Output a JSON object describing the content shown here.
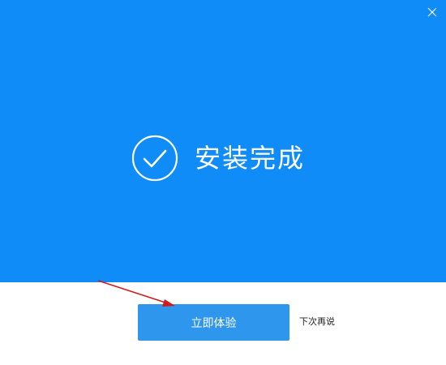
{
  "dialog": {
    "status_text": "安装完成",
    "primary_button_label": "立即体验",
    "secondary_link_label": "下次再说"
  },
  "icons": {
    "close": "close-icon",
    "success": "check-circle-icon"
  },
  "colors": {
    "hero_background": "#0f8cf7",
    "primary_button": "#2f96ee",
    "text_on_blue": "#ffffff",
    "annotation_arrow": "#d11a1a"
  }
}
